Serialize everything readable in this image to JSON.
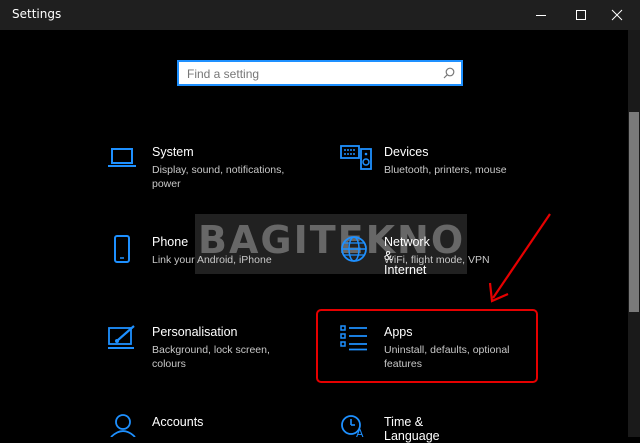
{
  "window": {
    "title": "Settings",
    "minimize_icon": "minimize-icon",
    "maximize_icon": "maximize-icon",
    "close_icon": "close-icon"
  },
  "search": {
    "placeholder": "Find a setting",
    "icon": "search-icon"
  },
  "tiles": [
    {
      "name": "System",
      "desc": "Display, sound, notifications, power",
      "icon": "laptop-icon"
    },
    {
      "name": "Devices",
      "desc": "Bluetooth, printers, mouse",
      "icon": "keyboard-speaker-icon"
    },
    {
      "name": "Phone",
      "desc": "Link your Android, iPhone",
      "icon": "phone-icon"
    },
    {
      "name": "Network & Internet",
      "desc": "WiFi, flight mode, VPN",
      "icon": "globe-icon"
    },
    {
      "name": "Personalisation",
      "desc": "Background, lock screen, colours",
      "icon": "paint-brush-icon"
    },
    {
      "name": "Apps",
      "desc": "Uninstall, defaults, optional features",
      "icon": "apps-list-icon"
    },
    {
      "name": "Accounts",
      "desc": "",
      "icon": "person-icon"
    },
    {
      "name": "Time & Language",
      "desc": "",
      "icon": "time-language-icon"
    }
  ],
  "watermark": "BAGITEKNO",
  "colors": {
    "accent": "#1e90ff",
    "highlight": "#e60000",
    "background": "#000000"
  }
}
